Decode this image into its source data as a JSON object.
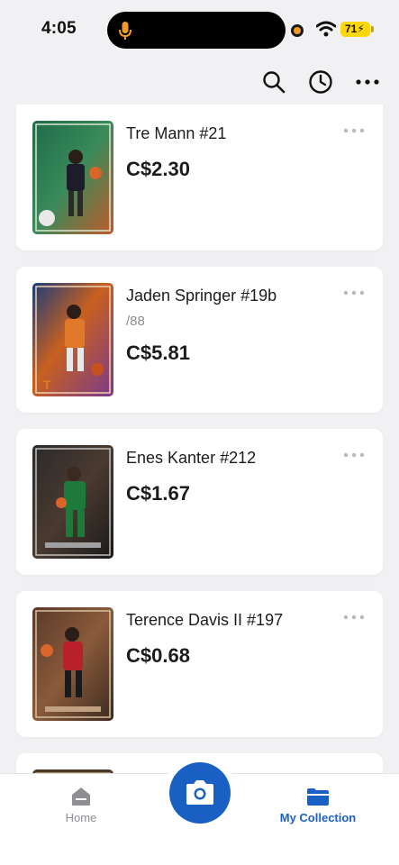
{
  "status_bar": {
    "time": "4:05",
    "battery": "71"
  },
  "cards": [
    {
      "name": "Tre Mann #21",
      "serial": "",
      "price": "C$2.30",
      "colors": [
        "#1f6b4a",
        "#c25a2a"
      ]
    },
    {
      "name": "Jaden Springer #19b",
      "serial": "/88",
      "price": "C$5.81",
      "colors": [
        "#c8601f",
        "#1a3d7a"
      ]
    },
    {
      "name": "Enes Kanter #212",
      "serial": "",
      "price": "C$1.67",
      "colors": [
        "#2a2a2a",
        "#1e7a3a"
      ]
    },
    {
      "name": "Terence Davis II #197",
      "serial": "",
      "price": "C$0.68",
      "colors": [
        "#5a3a2a",
        "#b8202a"
      ]
    }
  ],
  "bottom_nav": {
    "home_label": "Home",
    "collection_label": "My Collection"
  },
  "accent_color": "#1a5fc4"
}
